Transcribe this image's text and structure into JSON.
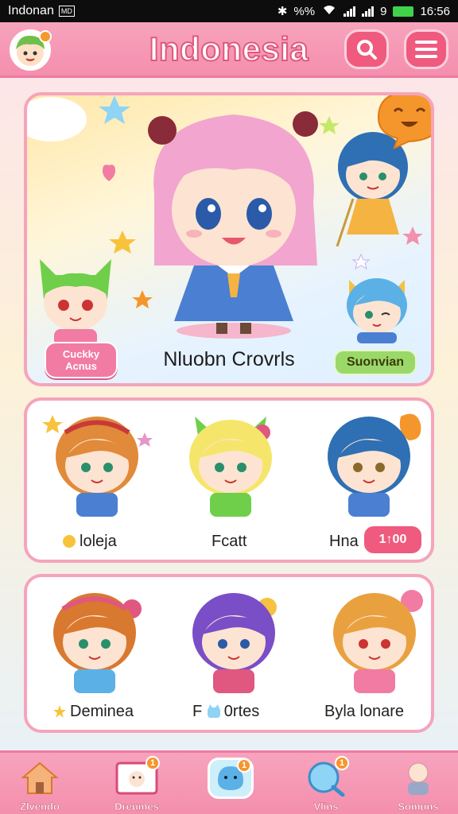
{
  "status_bar": {
    "carrier": "Indonan",
    "box_label": "MD",
    "time": "16:56",
    "net_text": "%%",
    "signal_2_label": "9"
  },
  "header": {
    "title": "Indonesia",
    "avatar_icon": "boy-avatar-icon",
    "search_icon": "search-icon",
    "menu_icon": "hamburger-menu-icon"
  },
  "hero": {
    "character_name": "Nluobn Crovrls",
    "left_badge_line1": "Cuckky",
    "left_badge_line2": "Acnus",
    "right_badge": "Suonvian"
  },
  "row1": {
    "items": [
      {
        "name": "loleja",
        "icon": "flower-icon"
      },
      {
        "name": "Fcatt"
      },
      {
        "name": "Hna"
      }
    ],
    "button_label": "1↑00"
  },
  "row2": {
    "items": [
      {
        "name": "Deminea",
        "icon": "star-icon"
      },
      {
        "name_prefix": "F",
        "name_suffix": "0rtes",
        "icon": "cat-icon"
      },
      {
        "name": "Byla lonare"
      }
    ]
  },
  "bottom_nav": [
    {
      "label": "Zlvendo",
      "icon": "house-icon",
      "badge": ""
    },
    {
      "label": "Dreumes",
      "icon": "photo-frame-icon",
      "badge": "1"
    },
    {
      "label": "",
      "icon": "mascot-icon",
      "badge": "1"
    },
    {
      "label": "Vlins",
      "icon": "search-character-icon",
      "badge": "1"
    },
    {
      "label": "Somuns",
      "icon": "profile-doll-icon",
      "badge": ""
    }
  ],
  "colors": {
    "header_pink": "#f48fae",
    "accent_pink": "#ef5a7e",
    "card_border": "#f5a4bb",
    "badge_orange": "#f5962c",
    "green_badge": "#9bd86a"
  }
}
